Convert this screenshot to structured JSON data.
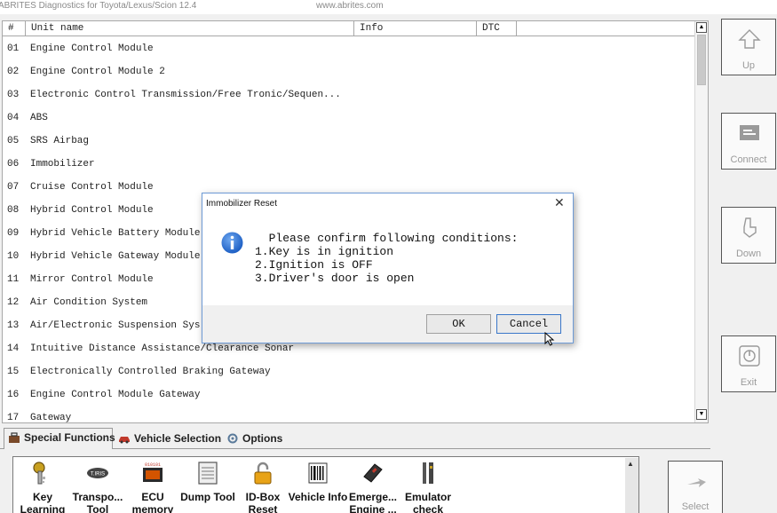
{
  "window": {
    "title": "ABRITES Diagnostics for Toyota/Lexus/Scion 12.4",
    "url": "www.abrites.com"
  },
  "table": {
    "columns": [
      "#",
      "Unit name",
      "Info",
      "DTC"
    ],
    "rows": [
      {
        "num": "01",
        "name": "Engine Control Module"
      },
      {
        "num": "02",
        "name": "Engine Control Module 2"
      },
      {
        "num": "03",
        "name": "Electronic Control Transmission/Free Tronic/Sequen..."
      },
      {
        "num": "04",
        "name": "ABS"
      },
      {
        "num": "05",
        "name": "SRS Airbag"
      },
      {
        "num": "06",
        "name": "Immobilizer"
      },
      {
        "num": "07",
        "name": "Cruise Control Module"
      },
      {
        "num": "08",
        "name": "Hybrid Control Module"
      },
      {
        "num": "09",
        "name": "Hybrid Vehicle Battery Module"
      },
      {
        "num": "10",
        "name": "Hybrid Vehicle Gateway Module"
      },
      {
        "num": "11",
        "name": "Mirror Control Module"
      },
      {
        "num": "12",
        "name": "Air Condition System"
      },
      {
        "num": "13",
        "name": "Air/Electronic Suspension Sys"
      },
      {
        "num": "14",
        "name": "Intuitive Distance Assistance/Clearance Sonar"
      },
      {
        "num": "15",
        "name": "Electronically Controlled Braking Gateway"
      },
      {
        "num": "16",
        "name": "Engine Control Module Gateway"
      },
      {
        "num": "17",
        "name": "Gateway"
      }
    ]
  },
  "side_buttons": {
    "up": "Up",
    "connect": "Connect",
    "down": "Down",
    "exit": "Exit",
    "select": "Select"
  },
  "tabs": [
    {
      "label": "Special Functions",
      "icon": "toolbox-icon"
    },
    {
      "label": "Vehicle Selection",
      "icon": "car-icon"
    },
    {
      "label": "Options",
      "icon": "gears-icon"
    }
  ],
  "tools": [
    {
      "label": "Key Learning",
      "icon": "key-icon"
    },
    {
      "label": "Transpo... Tool",
      "icon": "transponder-icon"
    },
    {
      "label": "ECU memory",
      "icon": "ecu-memory-icon"
    },
    {
      "label": "Dump Tool",
      "icon": "dump-icon"
    },
    {
      "label": "ID-Box Reset",
      "icon": "padlock-icon"
    },
    {
      "label": "Vehicle Info",
      "icon": "barcode-icon"
    },
    {
      "label": "Emerge... Engine ...",
      "icon": "emergency-key-icon"
    },
    {
      "label": "Emulator check",
      "icon": "emulator-icon"
    }
  ],
  "dialog": {
    "title": "Immobilizer Reset",
    "message_line1": "  Please confirm following conditions:",
    "message_line2": "1.Key is in ignition",
    "message_line3": "2.Ignition is OFF",
    "message_line4": "3.Driver's door is open",
    "ok_label": "OK",
    "cancel_label": "Cancel"
  }
}
